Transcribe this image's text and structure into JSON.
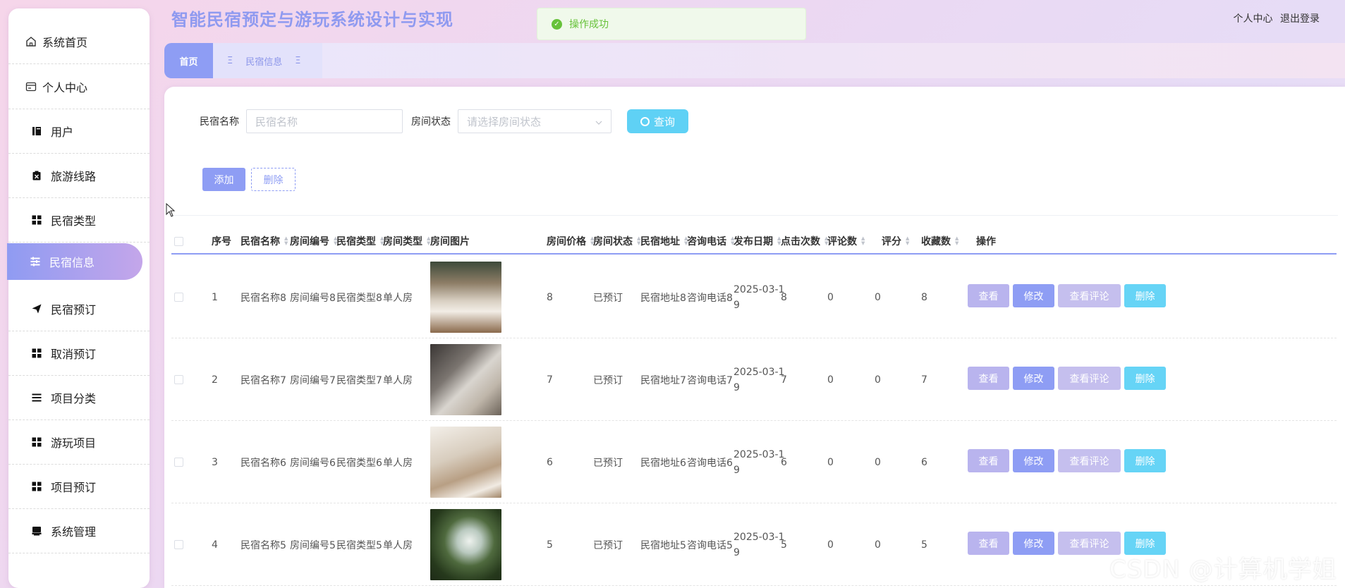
{
  "app": {
    "title": "智能民宿预定与游玩系统设计与实现",
    "toast": "操作成功",
    "user_center": "个人中心",
    "logout": "退出登录"
  },
  "sidebar": {
    "items": [
      {
        "label": "系统首页",
        "icon": "home-icon"
      },
      {
        "label": "个人中心",
        "icon": "card-icon"
      },
      {
        "label": "用户",
        "icon": "book-icon"
      },
      {
        "label": "旅游线路",
        "icon": "clipboard-icon"
      },
      {
        "label": "民宿类型",
        "icon": "grid-icon"
      },
      {
        "label": "民宿信息",
        "icon": "list-icon",
        "active": true
      },
      {
        "label": "民宿预订",
        "icon": "send-icon"
      },
      {
        "label": "取消预订",
        "icon": "grid-icon"
      },
      {
        "label": "项目分类",
        "icon": "list-icon"
      },
      {
        "label": "游玩项目",
        "icon": "grid-icon"
      },
      {
        "label": "项目预订",
        "icon": "grid-icon"
      },
      {
        "label": "系统管理",
        "icon": "printer-icon"
      }
    ]
  },
  "tabs": {
    "home": "首页",
    "current": "民宿信息",
    "current_glyph": "Ξ"
  },
  "search": {
    "name_label": "民宿名称",
    "name_placeholder": "民宿名称",
    "status_label": "房间状态",
    "status_placeholder": "请选择房间状态",
    "query_button": "查询"
  },
  "toolbar": {
    "add": "添加",
    "delete": "删除"
  },
  "table": {
    "columns": [
      "序号",
      "民宿名称",
      "房间编号",
      "民宿类型",
      "房间类型",
      "房间图片",
      "房间价格",
      "房间状态",
      "民宿地址",
      "咨询电话",
      "发布日期",
      "点击次数",
      "评论数",
      "评分",
      "收藏数",
      "操作"
    ],
    "action_labels": {
      "view": "查看",
      "edit": "修改",
      "comments": "查看评论",
      "delete": "删除"
    },
    "rows": [
      {
        "idx": "1",
        "name": "民宿名称8",
        "room_no": "房间编号8",
        "type": "民宿类型8",
        "room_type": "单人房",
        "price": "8",
        "status": "已预订",
        "address": "民宿地址8",
        "phone": "咨询电话8",
        "date": "2025-03-19",
        "clicks": "8",
        "comments": "0",
        "score": "0",
        "favorites": "8"
      },
      {
        "idx": "2",
        "name": "民宿名称7",
        "room_no": "房间编号7",
        "type": "民宿类型7",
        "room_type": "单人房",
        "price": "7",
        "status": "已预订",
        "address": "民宿地址7",
        "phone": "咨询电话7",
        "date": "2025-03-19",
        "clicks": "7",
        "comments": "0",
        "score": "0",
        "favorites": "7"
      },
      {
        "idx": "3",
        "name": "民宿名称6",
        "room_no": "房间编号6",
        "type": "民宿类型6",
        "room_type": "单人房",
        "price": "6",
        "status": "已预订",
        "address": "民宿地址6",
        "phone": "咨询电话6",
        "date": "2025-03-19",
        "clicks": "6",
        "comments": "0",
        "score": "0",
        "favorites": "6"
      },
      {
        "idx": "4",
        "name": "民宿名称5",
        "room_no": "房间编号5",
        "type": "民宿类型5",
        "room_type": "单人房",
        "price": "5",
        "status": "已预订",
        "address": "民宿地址5",
        "phone": "咨询电话5",
        "date": "2025-03-19",
        "clicks": "5",
        "comments": "0",
        "score": "0",
        "favorites": "5"
      }
    ]
  },
  "watermark": "CSDN @计算机学姐",
  "colors": {
    "accent": "#8e9df4",
    "query": "#5fd1f5",
    "title": "#8f9af0",
    "success": "#67c23a"
  }
}
